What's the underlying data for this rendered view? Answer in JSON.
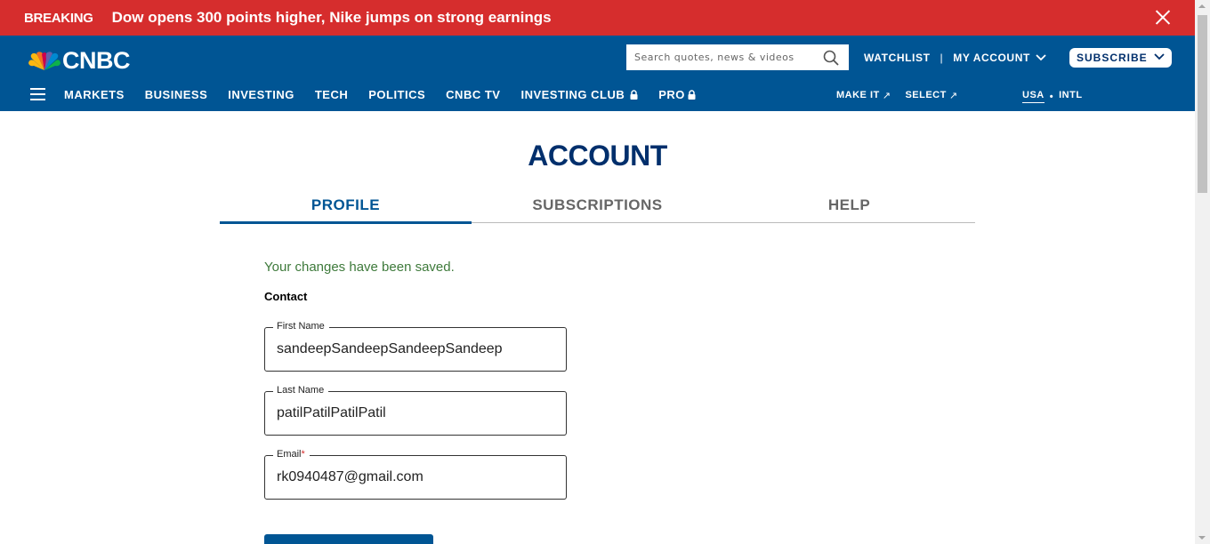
{
  "breaking": {
    "tag": "BREAKING",
    "headline": "Dow opens 300 points higher, Nike jumps on strong earnings"
  },
  "header": {
    "logo_text": "CNBC",
    "search_placeholder": "Search quotes, news & videos",
    "watchlist": "WATCHLIST",
    "separator": "|",
    "my_account": "MY ACCOUNT",
    "subscribe": "SUBSCRIBE",
    "nav": [
      "MARKETS",
      "BUSINESS",
      "INVESTING",
      "TECH",
      "POLITICS",
      "CNBC TV",
      "INVESTING CLUB",
      "PRO"
    ],
    "subnav": [
      "MAKE IT",
      "SELECT"
    ],
    "region": {
      "usa": "USA",
      "dot": "•",
      "intl": "INTL"
    }
  },
  "page": {
    "title": "ACCOUNT",
    "tabs": [
      "PROFILE",
      "SUBSCRIPTIONS",
      "HELP"
    ],
    "saved_message": "Your changes have been saved.",
    "section_title": "Contact",
    "fields": {
      "first_name": {
        "label": "First Name",
        "value": "sandeepSandeepSandeepSandeep"
      },
      "last_name": {
        "label": "Last Name",
        "value": "patilPatilPatilPatil"
      },
      "email": {
        "label": "Email",
        "required_mark": "*",
        "value": "rk0940487@gmail.com"
      }
    }
  },
  "colors": {
    "breaking_red": "#d62d2d",
    "brand_blue": "#005594",
    "title_navy": "#002f6c",
    "success_green": "#3e7a3b"
  }
}
